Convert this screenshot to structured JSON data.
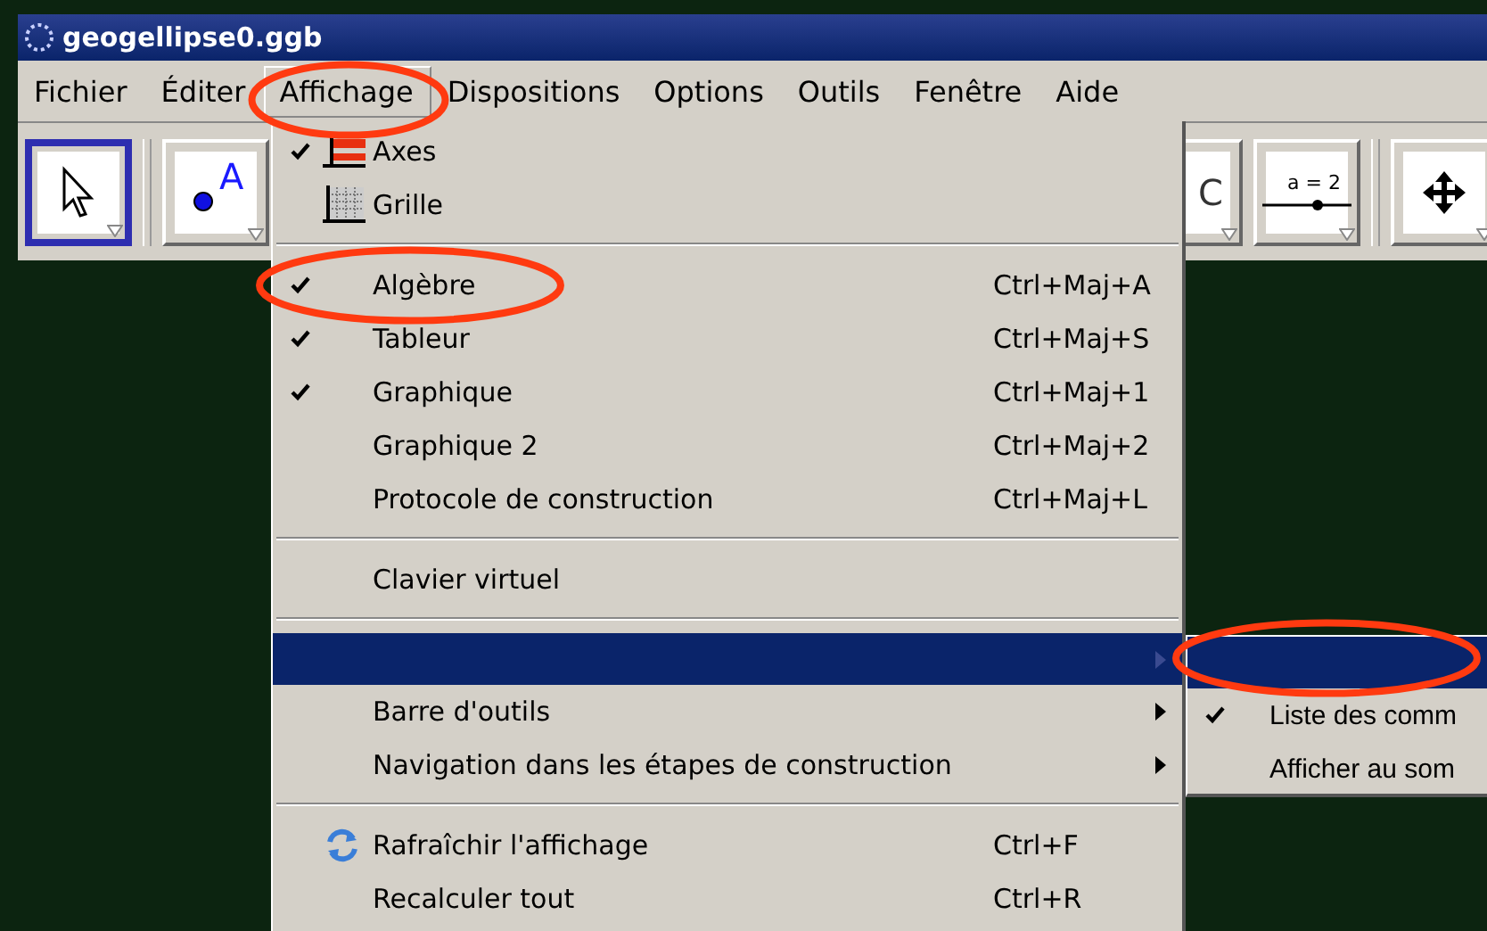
{
  "window": {
    "title": "geogellipse0.ggb"
  },
  "menu_bar": [
    {
      "label": "Fichier",
      "selected": false
    },
    {
      "label": "Éditer",
      "selected": false
    },
    {
      "label": "Affichage",
      "selected": true
    },
    {
      "label": "Dispositions",
      "selected": false
    },
    {
      "label": "Options",
      "selected": false
    },
    {
      "label": "Outils",
      "selected": false
    },
    {
      "label": "Fenêtre",
      "selected": false
    },
    {
      "label": "Aide",
      "selected": false
    }
  ],
  "toolbar": {
    "left": [
      {
        "kind": "pointer",
        "selected": true
      },
      {
        "kind": "point",
        "label": "A",
        "selected": false
      }
    ],
    "right": [
      {
        "kind": "circle",
        "label": "C",
        "selected": false
      },
      {
        "kind": "slider",
        "label": "a = 2",
        "selected": false
      },
      {
        "kind": "move",
        "selected": false
      }
    ]
  },
  "menu": {
    "sections": [
      [
        {
          "kind": "check",
          "label": "Axes",
          "checked": true
        },
        {
          "kind": "check",
          "label": "Grille",
          "checked": false
        }
      ],
      [
        {
          "kind": "check",
          "label": "Algèbre",
          "checked": true,
          "shortcut": "Ctrl+Maj+A"
        },
        {
          "kind": "check",
          "label": "Tableur",
          "checked": true,
          "shortcut": "Ctrl+Maj+S"
        },
        {
          "kind": "check",
          "label": "Graphique",
          "checked": true,
          "shortcut": "Ctrl+Maj+1"
        },
        {
          "kind": "check",
          "label": "Graphique 2",
          "checked": false,
          "shortcut": "Ctrl+Maj+2"
        },
        {
          "kind": "check",
          "label": "Protocole de construction",
          "checked": false,
          "shortcut": "Ctrl+Maj+L"
        }
      ],
      [
        {
          "kind": "action",
          "label": "Clavier virtuel"
        }
      ],
      [
        {
          "kind": "submenu",
          "selected": true
        },
        {
          "kind": "submenu",
          "label": "Barre d'outils",
          "selected": false
        },
        {
          "kind": "submenu",
          "label": "Navigation dans les étapes de construction",
          "selected": false
        }
      ],
      [
        {
          "kind": "action",
          "label": "Rafraîchir l'affichage",
          "shortcut": "Ctrl+F"
        },
        {
          "kind": "action",
          "label": "Recalculer tout",
          "shortcut": "Ctrl+R"
        }
      ]
    ]
  },
  "submenu": [
    {
      "selected": true
    },
    {
      "label": "Liste des comm",
      "checked": true,
      "selected": false
    },
    {
      "label": "Afficher au som",
      "checked": false,
      "selected": false
    }
  ],
  "annotations": [
    {
      "kind": "ellipse",
      "color": "#ff3a10"
    },
    {
      "kind": "ellipse",
      "color": "#ff3a10"
    },
    {
      "kind": "ellipse",
      "color": "#ff3a10"
    }
  ]
}
